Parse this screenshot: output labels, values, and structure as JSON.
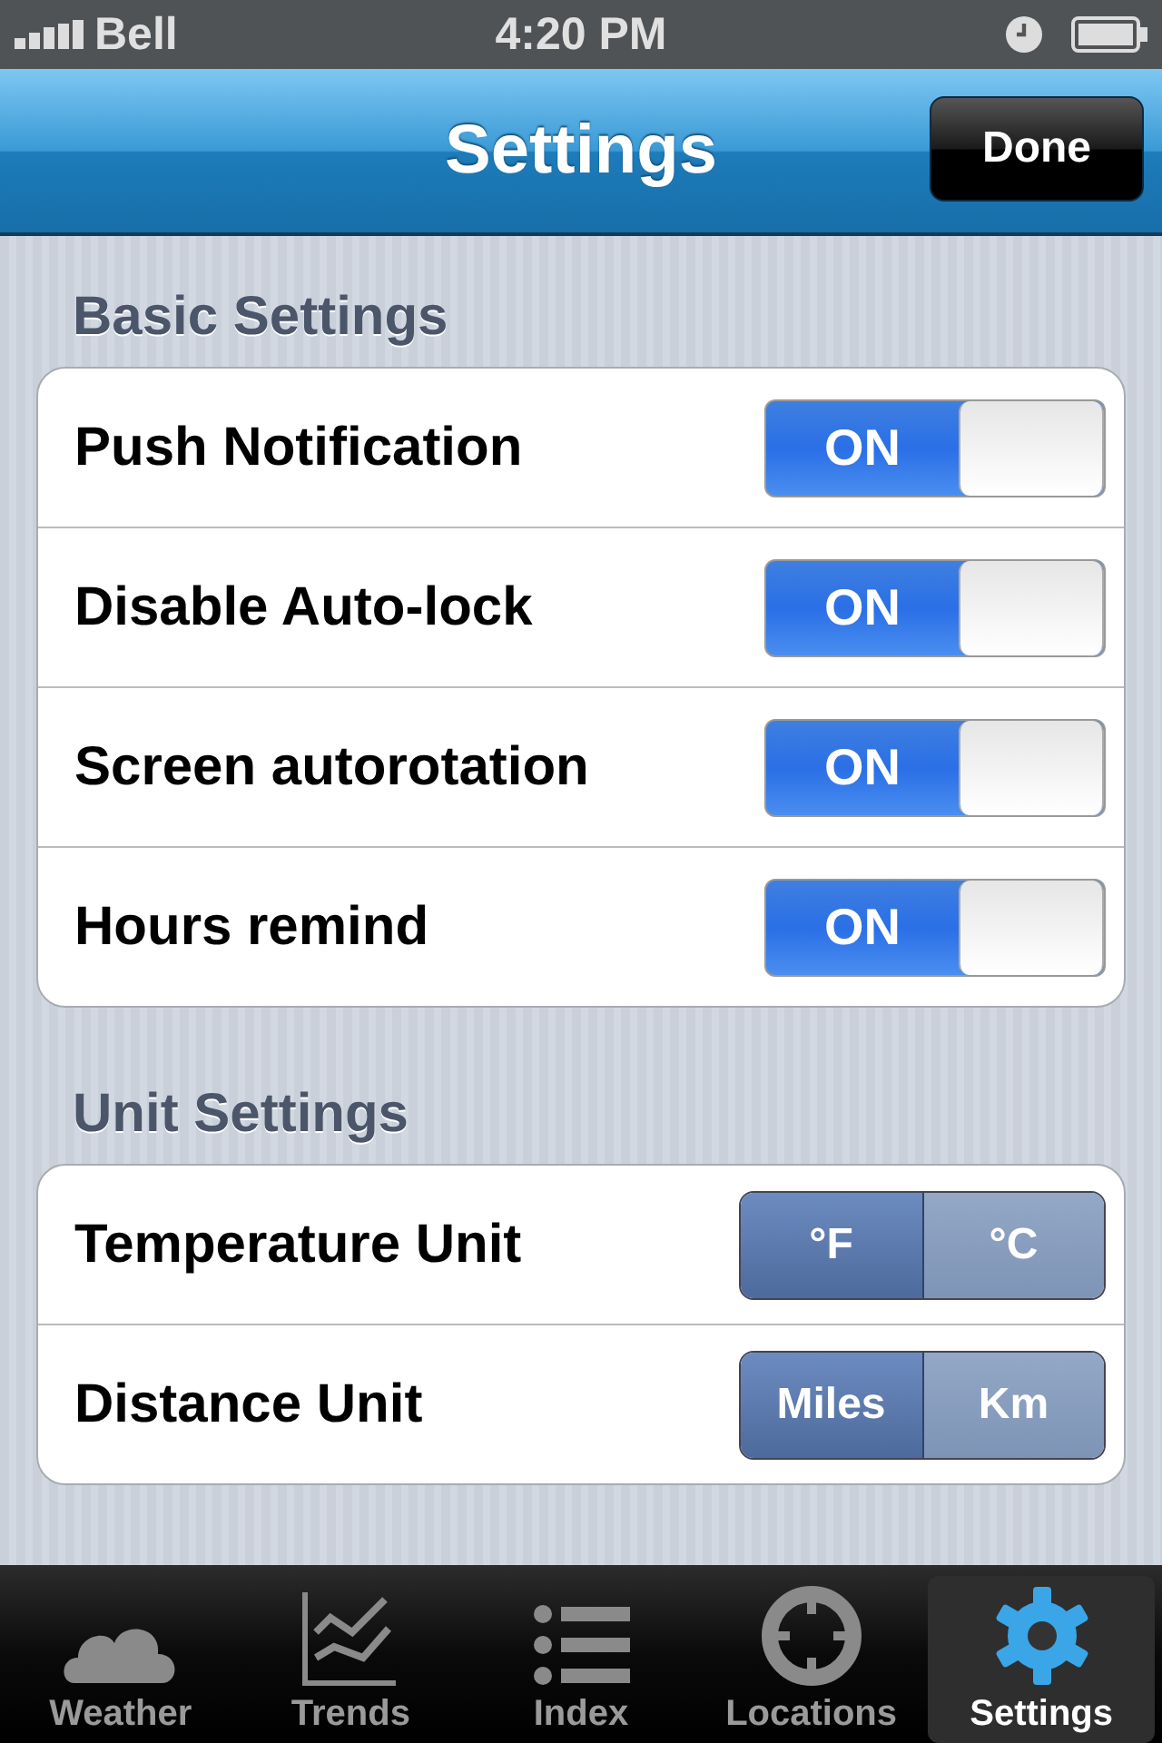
{
  "status_bar": {
    "carrier": "Bell",
    "time": "4:20 PM"
  },
  "nav_bar": {
    "title": "Settings",
    "button": "Done"
  },
  "sections": [
    {
      "title": "Basic Settings",
      "rows": [
        {
          "kind": "toggle",
          "label": "Push Notification",
          "on": true,
          "state_text": "ON"
        },
        {
          "kind": "toggle",
          "label": "Disable Auto-lock",
          "on": true,
          "state_text": "ON"
        },
        {
          "kind": "toggle",
          "label": "Screen autorotation",
          "on": true,
          "state_text": "ON"
        },
        {
          "kind": "toggle",
          "label": "Hours remind",
          "on": true,
          "state_text": "ON"
        }
      ]
    },
    {
      "title": "Unit Settings",
      "rows": [
        {
          "kind": "segmented",
          "label": "Temperature Unit",
          "options": [
            {
              "label": "°F",
              "selected": true
            },
            {
              "label": "°C",
              "selected": false
            }
          ]
        },
        {
          "kind": "segmented",
          "label": "Distance Unit",
          "options": [
            {
              "label": "Miles",
              "selected": true
            },
            {
              "label": "Km",
              "selected": false
            }
          ]
        }
      ]
    }
  ],
  "tab_bar": [
    {
      "label": "Weather",
      "selected": false
    },
    {
      "label": "Trends",
      "selected": false
    },
    {
      "label": "Index",
      "selected": false
    },
    {
      "label": "Locations",
      "selected": false
    },
    {
      "label": "Settings",
      "selected": true
    }
  ]
}
